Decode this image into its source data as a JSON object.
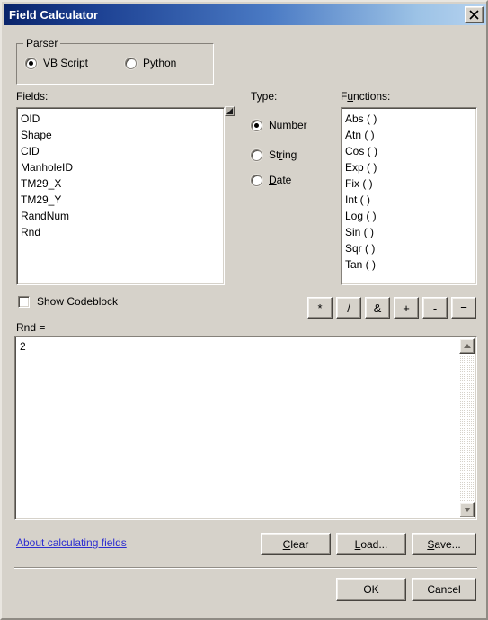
{
  "window": {
    "title": "Field Calculator",
    "close_label": "Close"
  },
  "parser": {
    "legend": "Parser",
    "options": [
      {
        "label": "VB Script",
        "selected": true
      },
      {
        "label": "Python",
        "selected": false
      }
    ]
  },
  "fields": {
    "label": "Fields:",
    "items": [
      "OID",
      "Shape",
      "CID",
      "ManholeID",
      "TM29_X",
      "TM29_Y",
      "RandNum",
      "Rnd"
    ]
  },
  "type": {
    "label": "Type:",
    "options": [
      {
        "label": "Number",
        "mnemonic": "",
        "selected": true
      },
      {
        "label": "String",
        "mnemonic": "r",
        "selected": false
      },
      {
        "label": "Date",
        "mnemonic": "D",
        "selected": false
      }
    ]
  },
  "functions": {
    "label_pre": "F",
    "label_mnemonic": "u",
    "label_post": "nctions:",
    "items": [
      "Abs ( )",
      "Atn ( )",
      "Cos ( )",
      "Exp ( )",
      "Fix ( )",
      "Int ( )",
      "Log ( )",
      "Sin ( )",
      "Sqr ( )",
      "Tan ( )"
    ]
  },
  "operators": [
    "*",
    "/",
    "&",
    "+",
    "-",
    "="
  ],
  "codeblock": {
    "label": "Show Codeblock",
    "checked": false
  },
  "expression": {
    "label": "Rnd =",
    "value": "2"
  },
  "footer": {
    "about_link": "About calculating fields",
    "clear": {
      "pre": "",
      "mnemonic": "C",
      "post": "lear"
    },
    "load": {
      "pre": "",
      "mnemonic": "L",
      "post": "oad..."
    },
    "save": {
      "pre": "",
      "mnemonic": "S",
      "post": "ave..."
    },
    "ok": "OK",
    "cancel": "Cancel"
  },
  "colors": {
    "dialog_face": "#d6d2ca",
    "titlebar_start": "#0a246a",
    "titlebar_end": "#b5d2ef",
    "link": "#2d2dd0",
    "listbox_bg": "#ffffff"
  }
}
